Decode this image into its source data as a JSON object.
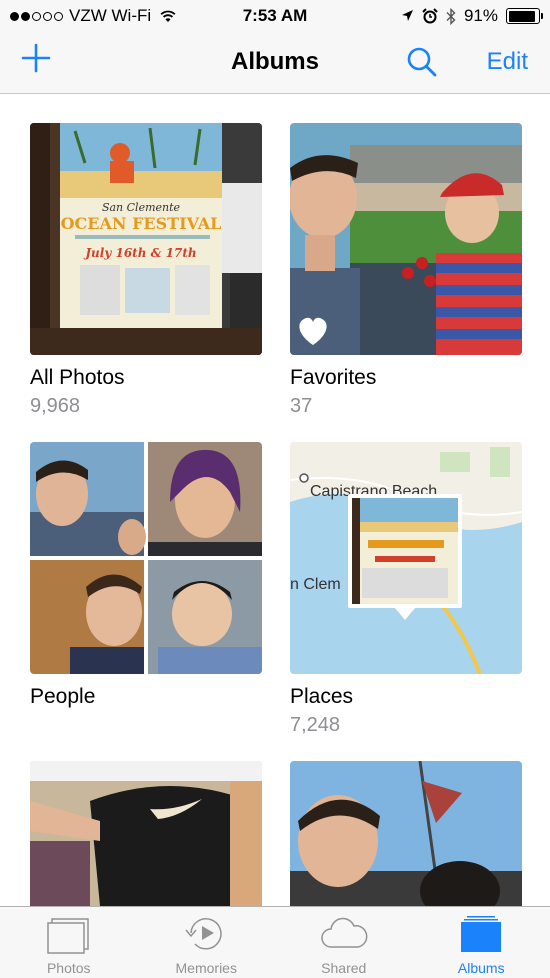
{
  "status_bar": {
    "carrier": "VZW Wi-Fi",
    "time": "7:53 AM",
    "battery": "91%",
    "battery_level": 0.91,
    "signal_dots_filled": 2,
    "signal_dots_total": 5
  },
  "nav": {
    "title": "Albums",
    "edit_label": "Edit",
    "accent_color": "#1a82fb"
  },
  "albums": [
    {
      "name": "All Photos",
      "count": "9,968"
    },
    {
      "name": "Favorites",
      "count": "37"
    },
    {
      "name": "People",
      "count": ""
    },
    {
      "name": "Places",
      "count": "7,248"
    }
  ],
  "map": {
    "label_top": "Capistrano Beach",
    "label_left": "n Clem"
  },
  "poster": {
    "line1": "San Clemente",
    "line2": "OCEAN FESTIVAL",
    "line3": "July 16th & 17th"
  },
  "tabs": [
    {
      "label": "Photos",
      "icon": "photos-icon"
    },
    {
      "label": "Memories",
      "icon": "memories-icon"
    },
    {
      "label": "Shared",
      "icon": "cloud-icon"
    },
    {
      "label": "Albums",
      "icon": "albums-icon",
      "active": true
    }
  ]
}
